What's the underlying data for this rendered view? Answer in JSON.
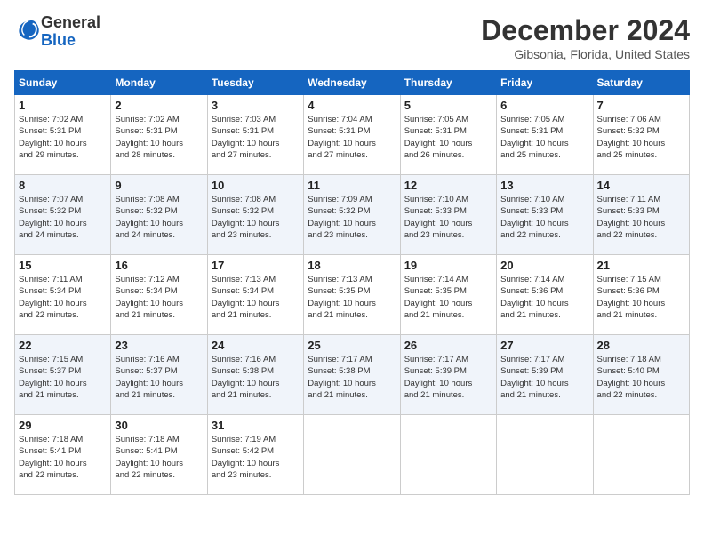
{
  "logo": {
    "general": "General",
    "blue": "Blue"
  },
  "header": {
    "month": "December 2024",
    "location": "Gibsonia, Florida, United States"
  },
  "weekdays": [
    "Sunday",
    "Monday",
    "Tuesday",
    "Wednesday",
    "Thursday",
    "Friday",
    "Saturday"
  ],
  "weeks": [
    [
      {
        "day": "1",
        "info": "Sunrise: 7:02 AM\nSunset: 5:31 PM\nDaylight: 10 hours\nand 29 minutes."
      },
      {
        "day": "2",
        "info": "Sunrise: 7:02 AM\nSunset: 5:31 PM\nDaylight: 10 hours\nand 28 minutes."
      },
      {
        "day": "3",
        "info": "Sunrise: 7:03 AM\nSunset: 5:31 PM\nDaylight: 10 hours\nand 27 minutes."
      },
      {
        "day": "4",
        "info": "Sunrise: 7:04 AM\nSunset: 5:31 PM\nDaylight: 10 hours\nand 27 minutes."
      },
      {
        "day": "5",
        "info": "Sunrise: 7:05 AM\nSunset: 5:31 PM\nDaylight: 10 hours\nand 26 minutes."
      },
      {
        "day": "6",
        "info": "Sunrise: 7:05 AM\nSunset: 5:31 PM\nDaylight: 10 hours\nand 25 minutes."
      },
      {
        "day": "7",
        "info": "Sunrise: 7:06 AM\nSunset: 5:32 PM\nDaylight: 10 hours\nand 25 minutes."
      }
    ],
    [
      {
        "day": "8",
        "info": "Sunrise: 7:07 AM\nSunset: 5:32 PM\nDaylight: 10 hours\nand 24 minutes."
      },
      {
        "day": "9",
        "info": "Sunrise: 7:08 AM\nSunset: 5:32 PM\nDaylight: 10 hours\nand 24 minutes."
      },
      {
        "day": "10",
        "info": "Sunrise: 7:08 AM\nSunset: 5:32 PM\nDaylight: 10 hours\nand 23 minutes."
      },
      {
        "day": "11",
        "info": "Sunrise: 7:09 AM\nSunset: 5:32 PM\nDaylight: 10 hours\nand 23 minutes."
      },
      {
        "day": "12",
        "info": "Sunrise: 7:10 AM\nSunset: 5:33 PM\nDaylight: 10 hours\nand 23 minutes."
      },
      {
        "day": "13",
        "info": "Sunrise: 7:10 AM\nSunset: 5:33 PM\nDaylight: 10 hours\nand 22 minutes."
      },
      {
        "day": "14",
        "info": "Sunrise: 7:11 AM\nSunset: 5:33 PM\nDaylight: 10 hours\nand 22 minutes."
      }
    ],
    [
      {
        "day": "15",
        "info": "Sunrise: 7:11 AM\nSunset: 5:34 PM\nDaylight: 10 hours\nand 22 minutes."
      },
      {
        "day": "16",
        "info": "Sunrise: 7:12 AM\nSunset: 5:34 PM\nDaylight: 10 hours\nand 21 minutes."
      },
      {
        "day": "17",
        "info": "Sunrise: 7:13 AM\nSunset: 5:34 PM\nDaylight: 10 hours\nand 21 minutes."
      },
      {
        "day": "18",
        "info": "Sunrise: 7:13 AM\nSunset: 5:35 PM\nDaylight: 10 hours\nand 21 minutes."
      },
      {
        "day": "19",
        "info": "Sunrise: 7:14 AM\nSunset: 5:35 PM\nDaylight: 10 hours\nand 21 minutes."
      },
      {
        "day": "20",
        "info": "Sunrise: 7:14 AM\nSunset: 5:36 PM\nDaylight: 10 hours\nand 21 minutes."
      },
      {
        "day": "21",
        "info": "Sunrise: 7:15 AM\nSunset: 5:36 PM\nDaylight: 10 hours\nand 21 minutes."
      }
    ],
    [
      {
        "day": "22",
        "info": "Sunrise: 7:15 AM\nSunset: 5:37 PM\nDaylight: 10 hours\nand 21 minutes."
      },
      {
        "day": "23",
        "info": "Sunrise: 7:16 AM\nSunset: 5:37 PM\nDaylight: 10 hours\nand 21 minutes."
      },
      {
        "day": "24",
        "info": "Sunrise: 7:16 AM\nSunset: 5:38 PM\nDaylight: 10 hours\nand 21 minutes."
      },
      {
        "day": "25",
        "info": "Sunrise: 7:17 AM\nSunset: 5:38 PM\nDaylight: 10 hours\nand 21 minutes."
      },
      {
        "day": "26",
        "info": "Sunrise: 7:17 AM\nSunset: 5:39 PM\nDaylight: 10 hours\nand 21 minutes."
      },
      {
        "day": "27",
        "info": "Sunrise: 7:17 AM\nSunset: 5:39 PM\nDaylight: 10 hours\nand 21 minutes."
      },
      {
        "day": "28",
        "info": "Sunrise: 7:18 AM\nSunset: 5:40 PM\nDaylight: 10 hours\nand 22 minutes."
      }
    ],
    [
      {
        "day": "29",
        "info": "Sunrise: 7:18 AM\nSunset: 5:41 PM\nDaylight: 10 hours\nand 22 minutes."
      },
      {
        "day": "30",
        "info": "Sunrise: 7:18 AM\nSunset: 5:41 PM\nDaylight: 10 hours\nand 22 minutes."
      },
      {
        "day": "31",
        "info": "Sunrise: 7:19 AM\nSunset: 5:42 PM\nDaylight: 10 hours\nand 23 minutes."
      },
      null,
      null,
      null,
      null
    ]
  ]
}
